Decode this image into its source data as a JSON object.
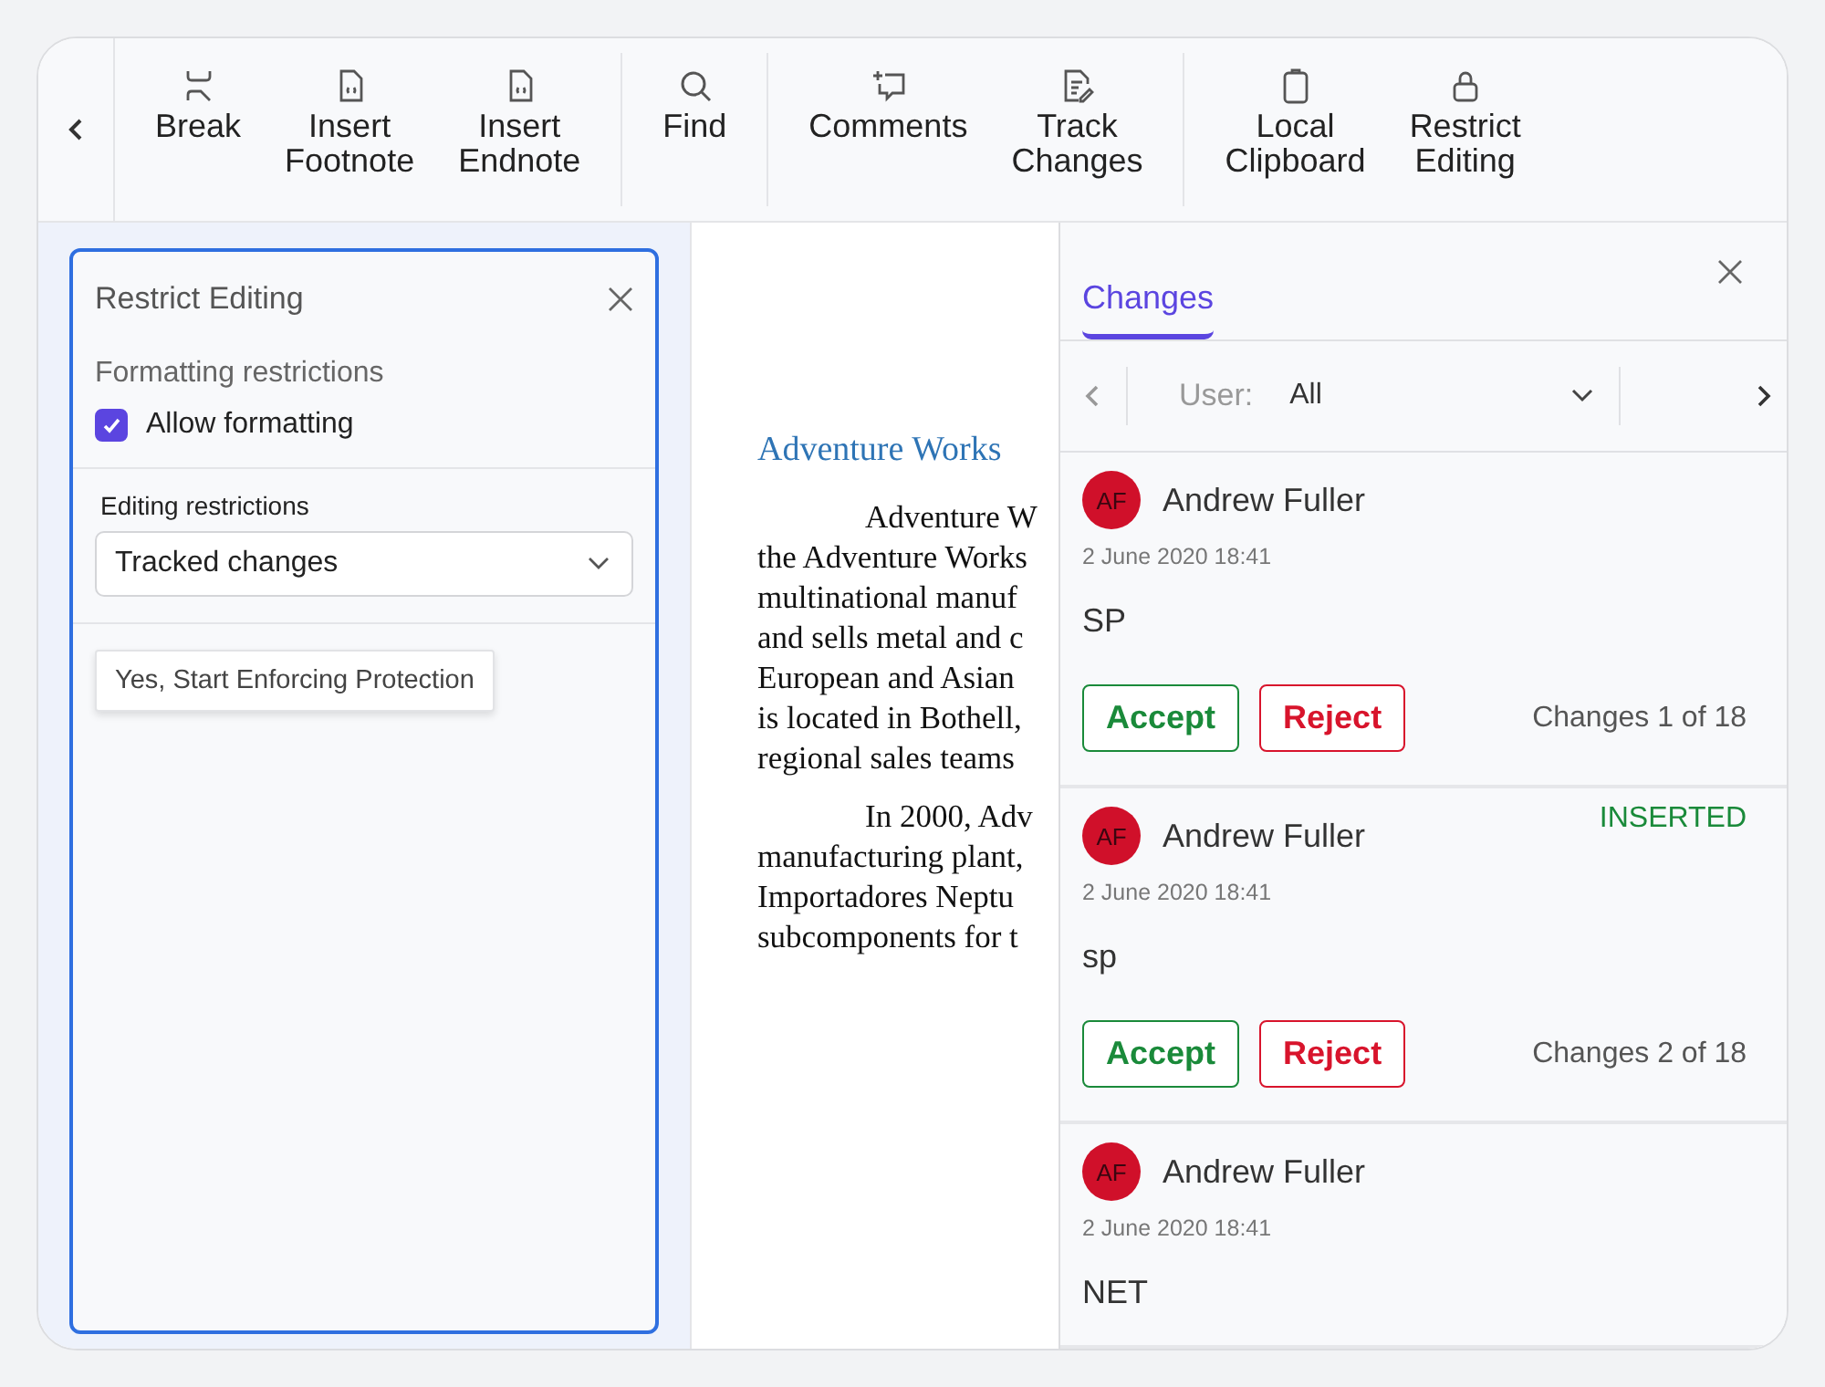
{
  "toolbar": {
    "groups": [
      [
        {
          "label": "Break",
          "kind": "break"
        },
        {
          "label": "Insert\nFootnote",
          "kind": "note"
        },
        {
          "label": "Insert\nEndnote",
          "kind": "note"
        }
      ],
      [
        {
          "label": "Find",
          "kind": "search"
        }
      ],
      [
        {
          "label": "Comments",
          "kind": "comment"
        },
        {
          "label": "Track\nChanges",
          "kind": "track"
        }
      ],
      [
        {
          "label": "Local\nClipboard",
          "kind": "clipboard"
        },
        {
          "label": "Restrict\nEditing",
          "kind": "lock"
        }
      ]
    ]
  },
  "restrict_panel": {
    "title": "Restrict Editing",
    "formatting_heading": "Formatting restrictions",
    "allow_formatting": {
      "label": "Allow formatting",
      "checked": true
    },
    "editing_heading": "Editing restrictions",
    "editing_select": {
      "value": "Tracked changes"
    },
    "enforce_button": "Yes, Start Enforcing Protection"
  },
  "document": {
    "heading": "Adventure Works",
    "paragraphs": [
      [
        "Adventure W",
        "the Adventure Works",
        "multinational manuf",
        "and sells metal and c",
        "European and Asian",
        "is located in Bothell,",
        "regional sales teams"
      ],
      [
        "In 2000, Adv",
        "manufacturing plant,",
        "Importadores Neptu",
        "subcomponents for t"
      ]
    ]
  },
  "changes_panel": {
    "tab": {
      "label": "Changes",
      "selected": true
    },
    "user_label": "User:",
    "user_select": {
      "value": "All"
    },
    "cards": [
      {
        "initials": "AF",
        "author": "Andrew Fuller",
        "date": "2 June 2020 18:41",
        "text": "SP",
        "accept": "Accept",
        "reject": "Reject",
        "counter": "Changes 1 of 18"
      },
      {
        "initials": "AF",
        "author": "Andrew Fuller",
        "date": "2 June 2020 18:41",
        "type_label": "INSERTED",
        "text": "sp",
        "accept": "Accept",
        "reject": "Reject",
        "counter": "Changes 2 of 18"
      },
      {
        "initials": "AF",
        "author": "Andrew Fuller",
        "date": "2 June 2020 18:41",
        "text": "NET"
      }
    ]
  }
}
